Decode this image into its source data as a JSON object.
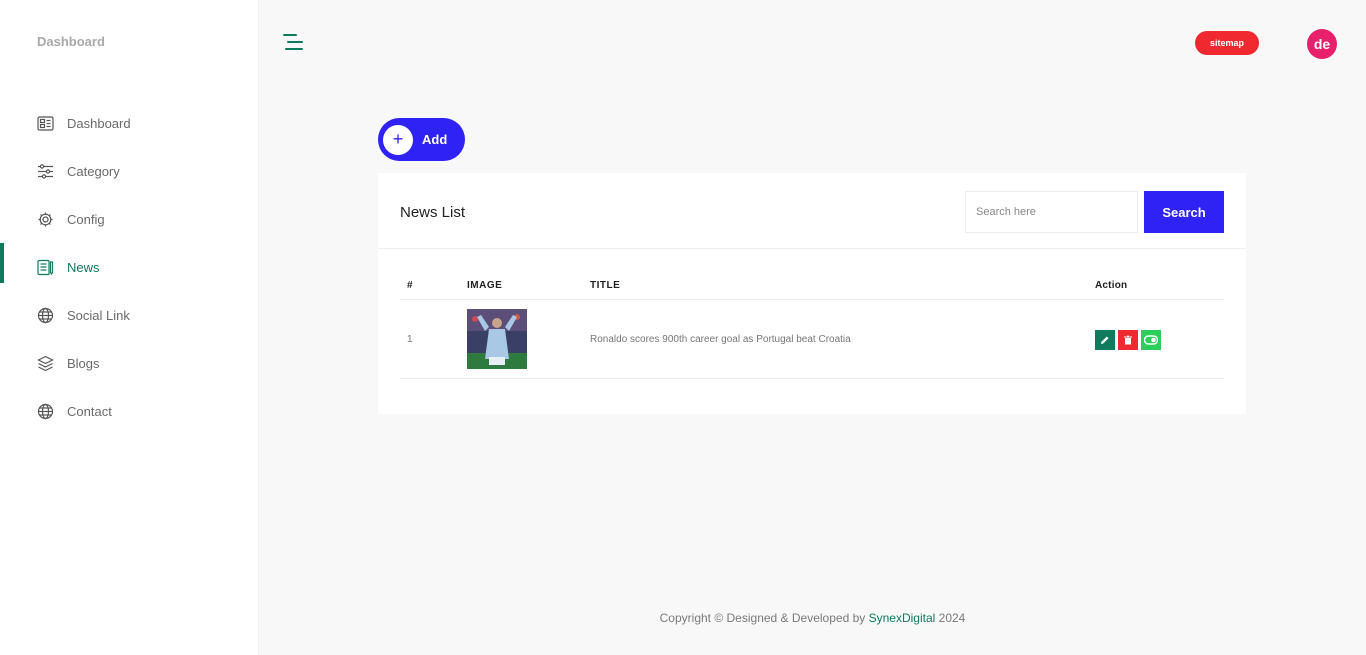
{
  "sidebar": {
    "brand": "Dashboard",
    "items": [
      {
        "label": "Dashboard",
        "icon": "dashboard-icon"
      },
      {
        "label": "Category",
        "icon": "sliders-icon"
      },
      {
        "label": "Config",
        "icon": "gear-icon"
      },
      {
        "label": "News",
        "icon": "news-icon",
        "active": true
      },
      {
        "label": "Social Link",
        "icon": "globe-icon"
      },
      {
        "label": "Blogs",
        "icon": "layers-icon"
      },
      {
        "label": "Contact",
        "icon": "globe-icon"
      }
    ]
  },
  "header": {
    "sitemap_label": "sitemap",
    "avatar_initials": "de"
  },
  "add_button": {
    "label": "Add",
    "plus": "+"
  },
  "news_list": {
    "title": "News List",
    "search_placeholder": "Search here",
    "search_label": "Search",
    "columns": [
      "#",
      "IMAGE",
      "TITLE",
      "Action"
    ],
    "rows": [
      {
        "index": "1",
        "title": "Ronaldo scores 900th career goal as Portugal beat Croatia"
      }
    ]
  },
  "footer": {
    "prefix": "Copyright © Designed & Developed by",
    "brand": "SynexDigital",
    "year": "2024"
  },
  "colors": {
    "accent": "#0f7a5c",
    "primary": "#2e22f5",
    "danger": "#f0282f",
    "success": "#2bd05a",
    "avatar": "#e9206c"
  }
}
